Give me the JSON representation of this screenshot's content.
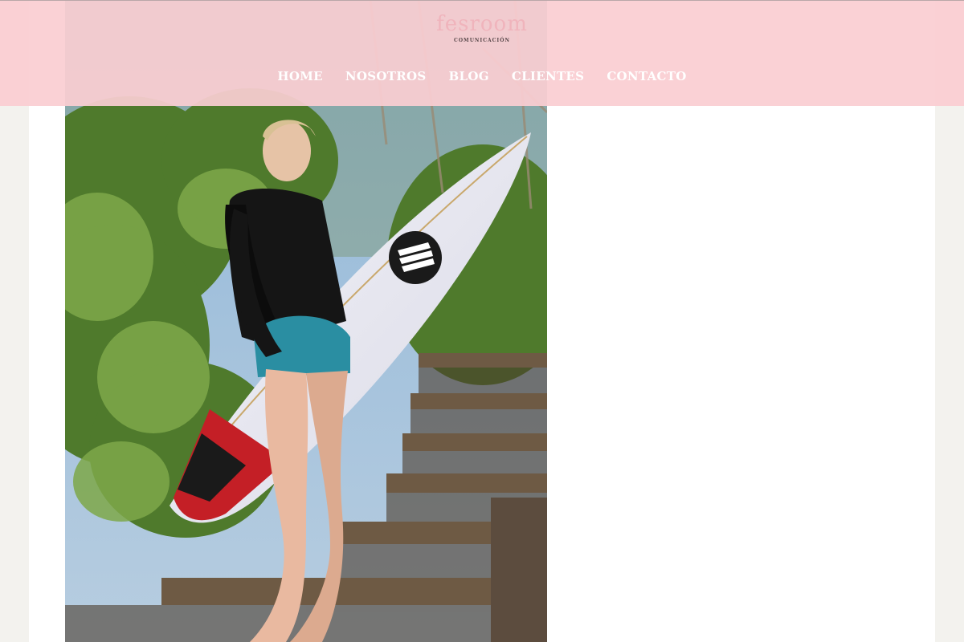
{
  "header": {
    "logo_text": "fesroom",
    "logo_subtitle": "COMUNICACIÓN",
    "nav": [
      {
        "label": "HOME"
      },
      {
        "label": "NOSOTROS"
      },
      {
        "label": "BLOG"
      },
      {
        "label": "CLIENTES"
      },
      {
        "label": "CONTACTO"
      }
    ]
  },
  "colors": {
    "header_bg": "#facdd2",
    "page_bg": "#f3f2ee",
    "card_bg": "#ffffff",
    "nav_text": "#ffffff"
  },
  "photo": {
    "subject": "surfer-with-surfboard-photo"
  }
}
